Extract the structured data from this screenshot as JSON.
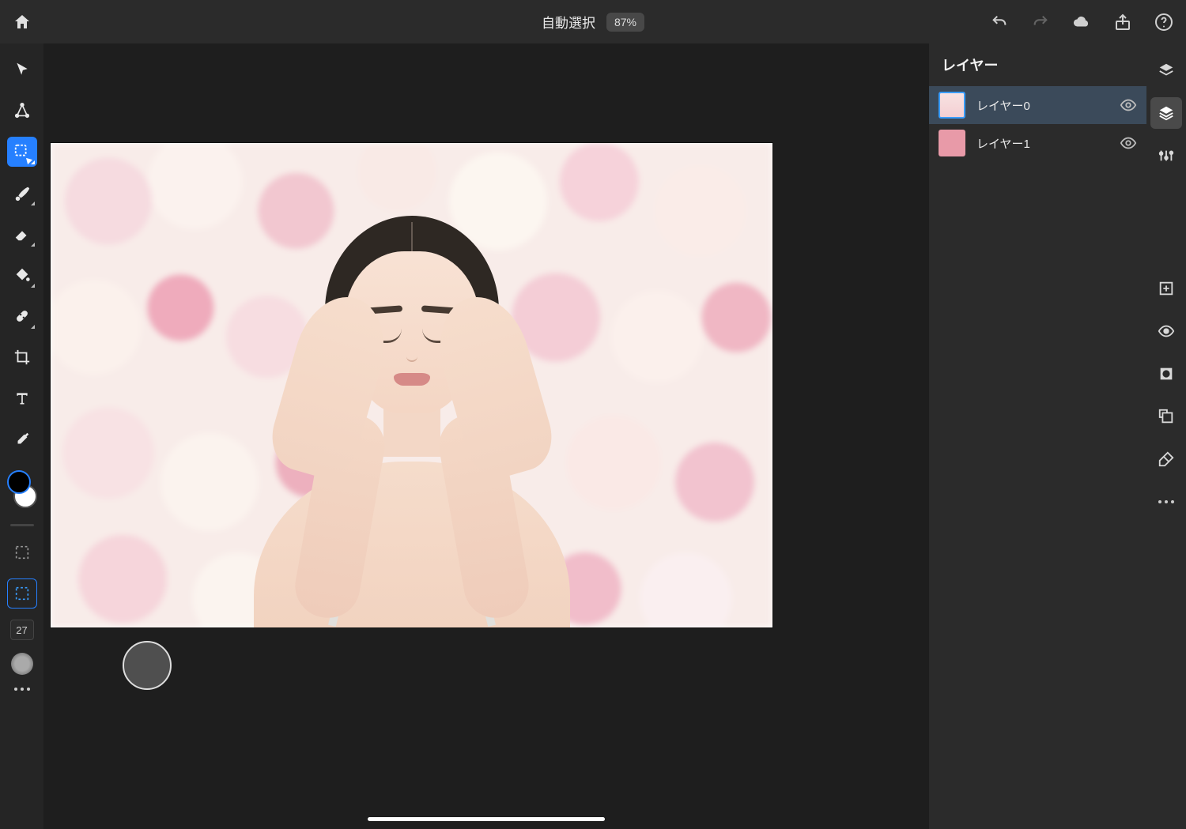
{
  "header": {
    "title": "自動選択",
    "zoom": "87%"
  },
  "layers_panel": {
    "title": "レイヤー",
    "items": [
      {
        "name": "レイヤー0",
        "selected": true
      },
      {
        "name": "レイヤー1",
        "selected": false
      }
    ]
  },
  "brush": {
    "size_label": "27"
  },
  "colors": {
    "foreground": "#000000",
    "background": "#ffffff"
  }
}
